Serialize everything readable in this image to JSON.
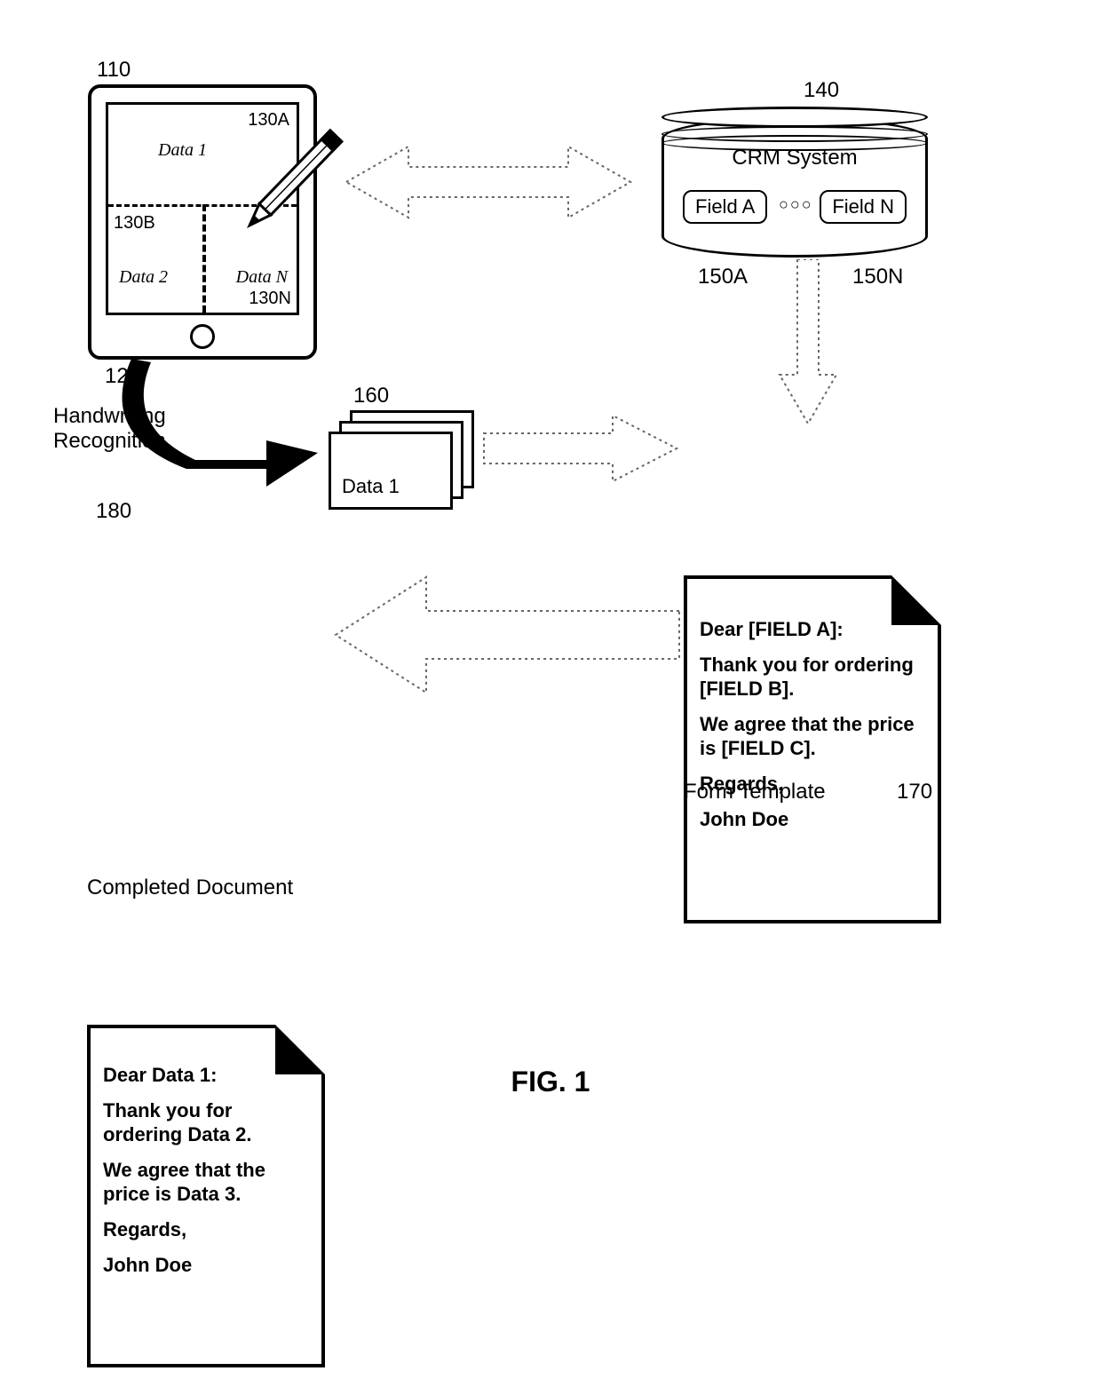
{
  "figure_label": "FIG. 1",
  "refs": {
    "tablet": "110",
    "screen": "120",
    "regionA": "130A",
    "regionB": "130B",
    "regionN": "130N",
    "crm": "140",
    "fieldA_ref": "150A",
    "fieldN_ref": "150N",
    "data_cards": "160",
    "template": "170",
    "completed": "180"
  },
  "tablet": {
    "regionA_label": "Data 1",
    "regionB_label": "Data 2",
    "regionN_label": "Data N"
  },
  "handwriting_label": "Handwriting\nRecognition",
  "crm": {
    "title": "CRM System",
    "fieldA": "Field A",
    "fieldN": "Field N",
    "dots": "○○○"
  },
  "data_card_label": "Data 1",
  "template_doc": {
    "line1": "Dear [FIELD A]:",
    "line2": "Thank you for ordering [FIELD B].",
    "line3": "We agree that the price is [FIELD C].",
    "line4": "Regards,",
    "line5": "John Doe",
    "caption": "Form Template"
  },
  "completed_doc": {
    "line1": "Dear Data 1:",
    "line2": "Thank you for ordering Data 2.",
    "line3": "We agree that the price is Data 3.",
    "line4": "Regards,",
    "line5": "John Doe",
    "caption": "Completed Document"
  }
}
